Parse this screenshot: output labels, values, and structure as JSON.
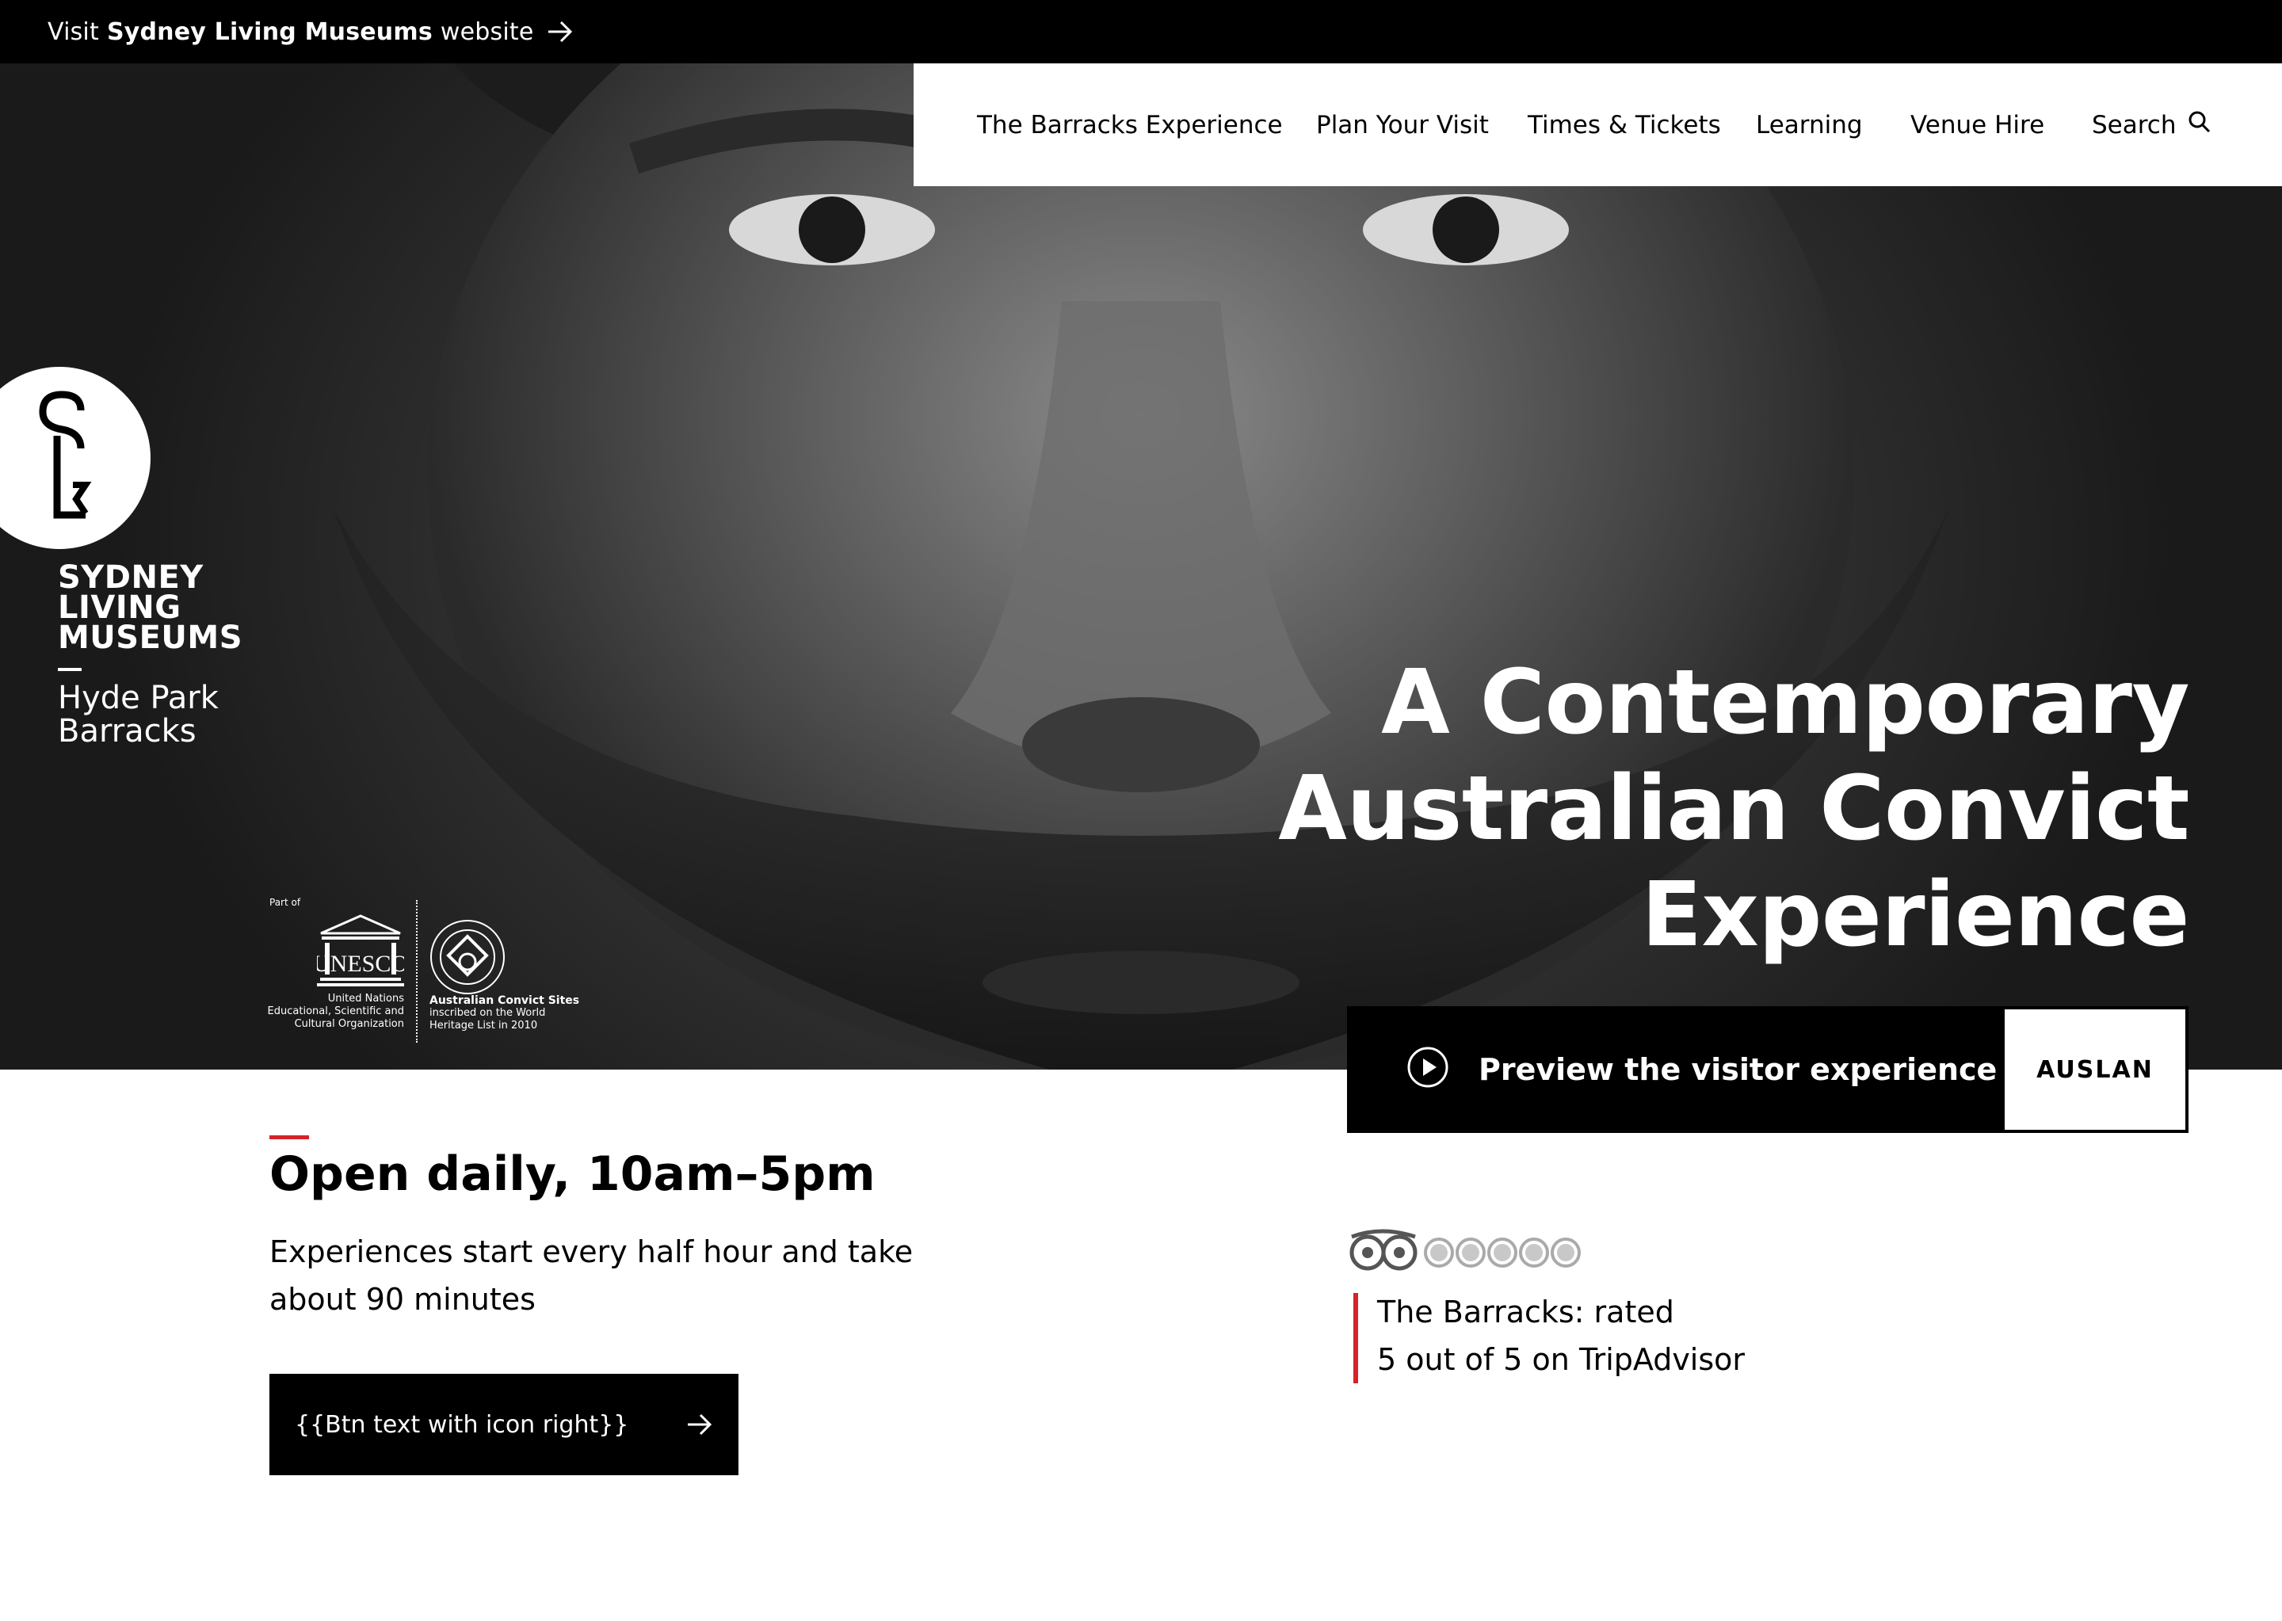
{
  "topbar": {
    "prefix": "Visit",
    "brand": "Sydney Living Museums",
    "suffix": "website",
    "arrow_icon": "arrow-right-icon"
  },
  "nav": {
    "items": [
      {
        "label": "The Barracks Experience"
      },
      {
        "label": "Plan Your Visit"
      },
      {
        "label": "Times & Tickets"
      },
      {
        "label": "Learning"
      },
      {
        "label": "Venue Hire"
      }
    ],
    "search_label": "Search",
    "search_icon": "search-icon"
  },
  "logo": {
    "title_lines": [
      "SYDNEY",
      "LIVING",
      "MUSEUMS"
    ],
    "subtitle_lines": [
      "Hyde Park",
      "Barracks"
    ]
  },
  "unesco": {
    "part_of": "Part of",
    "un_lines": [
      "United Nations",
      "Educational, Scientific and",
      "Cultural Organization"
    ],
    "sites_title": "Australian Convict Sites",
    "sites_lines": [
      "inscribed on the World",
      "Heritage List in 2010"
    ],
    "wordmark": "UNESCO"
  },
  "hero": {
    "heading_lines": [
      "A Contemporary",
      "Australian Convict",
      "Experience"
    ]
  },
  "preview": {
    "label": "Preview the visitor experience",
    "icon": "play-circle-icon",
    "auslan_label": "AUSLAN"
  },
  "info": {
    "title": "Open daily, 10am–5pm",
    "description_lines": [
      "Experiences start every half hour and take",
      "about 90 minutes"
    ],
    "button_label": "{{Btn text with icon right}}",
    "button_icon": "arrow-right-icon"
  },
  "tripadvisor": {
    "rating_icon": "tripadvisor-owl-icon",
    "rating": 0,
    "rating_max": 5,
    "text_lines": [
      "The Barracks: rated",
      "5 out of 5 on TripAdvisor"
    ]
  },
  "colors": {
    "accent_red": "#d4232a",
    "black": "#000000",
    "white": "#ffffff"
  }
}
